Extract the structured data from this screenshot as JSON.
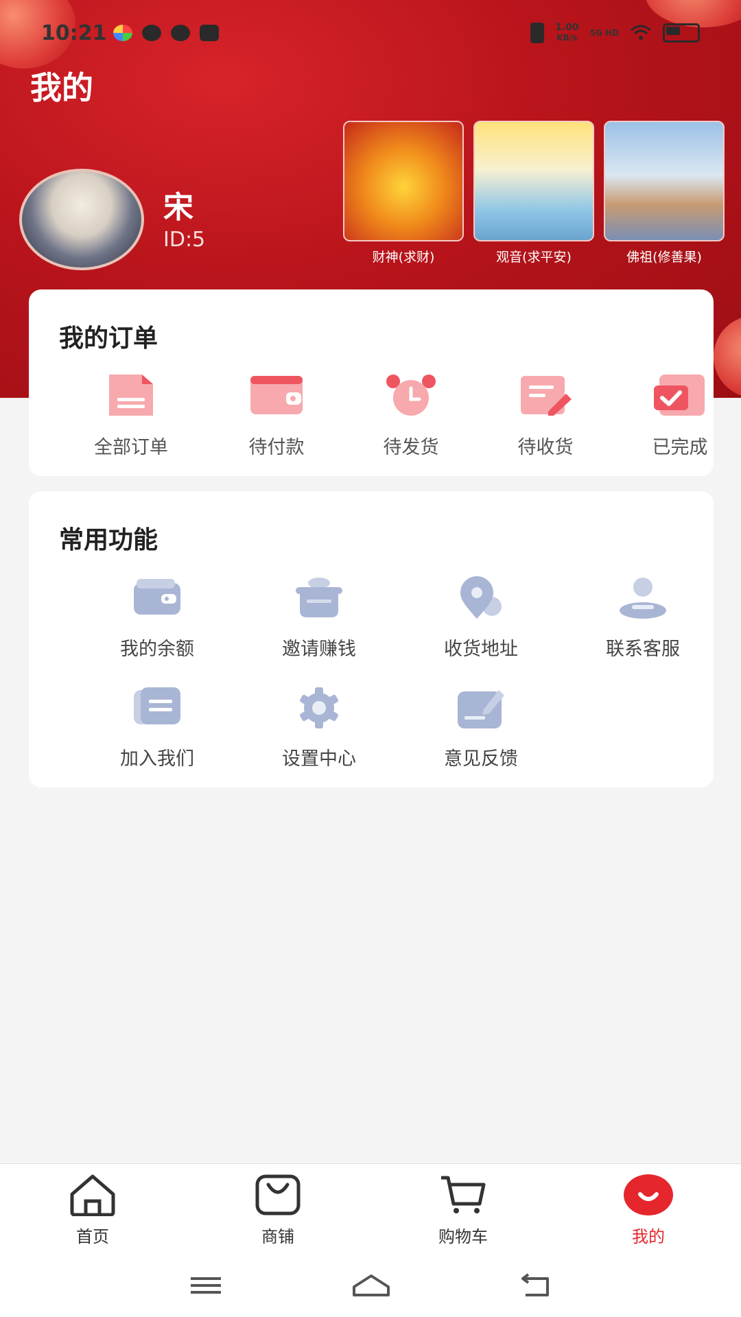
{
  "status_bar": {
    "time": "10:21",
    "net_speed_value": "1.00",
    "net_speed_unit": "KB/s",
    "net_type": "5G HD"
  },
  "header": {
    "title": "我的"
  },
  "user": {
    "name": "宋",
    "id": "ID:5"
  },
  "deities": [
    {
      "label": "财神(求财)"
    },
    {
      "label": "观音(求平安)"
    },
    {
      "label": "佛祖(修善果)"
    }
  ],
  "orders": {
    "title": "我的订单",
    "items": [
      {
        "label": "全部订单",
        "icon": "document-icon"
      },
      {
        "label": "待付款",
        "icon": "wallet-icon"
      },
      {
        "label": "待发货",
        "icon": "alarm-clock-icon"
      },
      {
        "label": "待收货",
        "icon": "edit-document-icon"
      },
      {
        "label": "已完成",
        "icon": "check-box-icon"
      }
    ]
  },
  "functions": {
    "title": "常用功能",
    "items": [
      {
        "label": "我的余额",
        "icon": "wallet-icon"
      },
      {
        "label": "邀请赚钱",
        "icon": "pot-icon"
      },
      {
        "label": "收货地址",
        "icon": "location-pin-icon"
      },
      {
        "label": "联系客服",
        "icon": "user-service-icon"
      },
      {
        "label": "加入我们",
        "icon": "card-icon"
      },
      {
        "label": "设置中心",
        "icon": "gear-icon"
      },
      {
        "label": "意见反馈",
        "icon": "feedback-icon"
      }
    ]
  },
  "bottom_nav": {
    "items": [
      {
        "label": "首页",
        "icon": "home-icon"
      },
      {
        "label": "商铺",
        "icon": "shopping-bag-icon"
      },
      {
        "label": "购物车",
        "icon": "cart-icon"
      },
      {
        "label": "我的",
        "icon": "smile-icon",
        "active": true
      }
    ]
  },
  "colors": {
    "brand_red": "#e5272d",
    "order_icon_pink": "#f7a9ad",
    "function_icon_blue": "#a9b5d4"
  }
}
